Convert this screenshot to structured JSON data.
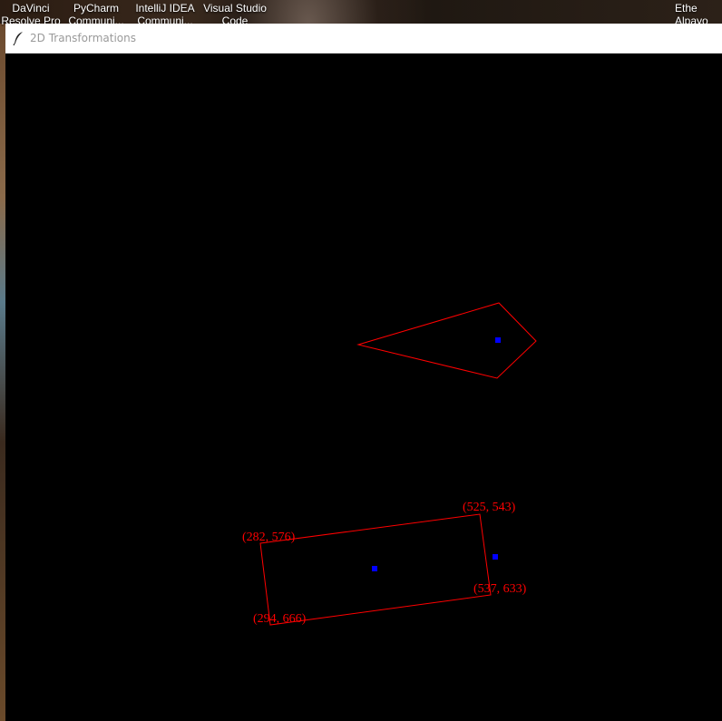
{
  "desktop": {
    "icons": [
      {
        "label": "DaVinci\nResolve Pro"
      },
      {
        "label": "PyCharm\nCommuni..."
      },
      {
        "label": "IntelliJ IDEA\nCommuni..."
      },
      {
        "label": "Visual Studio\nCode"
      },
      {
        "label": "Ethe\nAlpayo"
      }
    ]
  },
  "window": {
    "title": "2D Transformations",
    "icon": "feather-icon"
  },
  "colors": {
    "canvas_bg": "#000000",
    "shape_stroke": "#ff0000",
    "center_marker": "#0000ff",
    "label_text": "#ff0000"
  },
  "canvas": {
    "labels": [
      {
        "id": "tr",
        "text": "(525, 543)"
      },
      {
        "id": "tl",
        "text": "(282, 576)"
      },
      {
        "id": "br",
        "text": "(537, 633)"
      },
      {
        "id": "bl",
        "text": "(294, 666)"
      }
    ]
  }
}
